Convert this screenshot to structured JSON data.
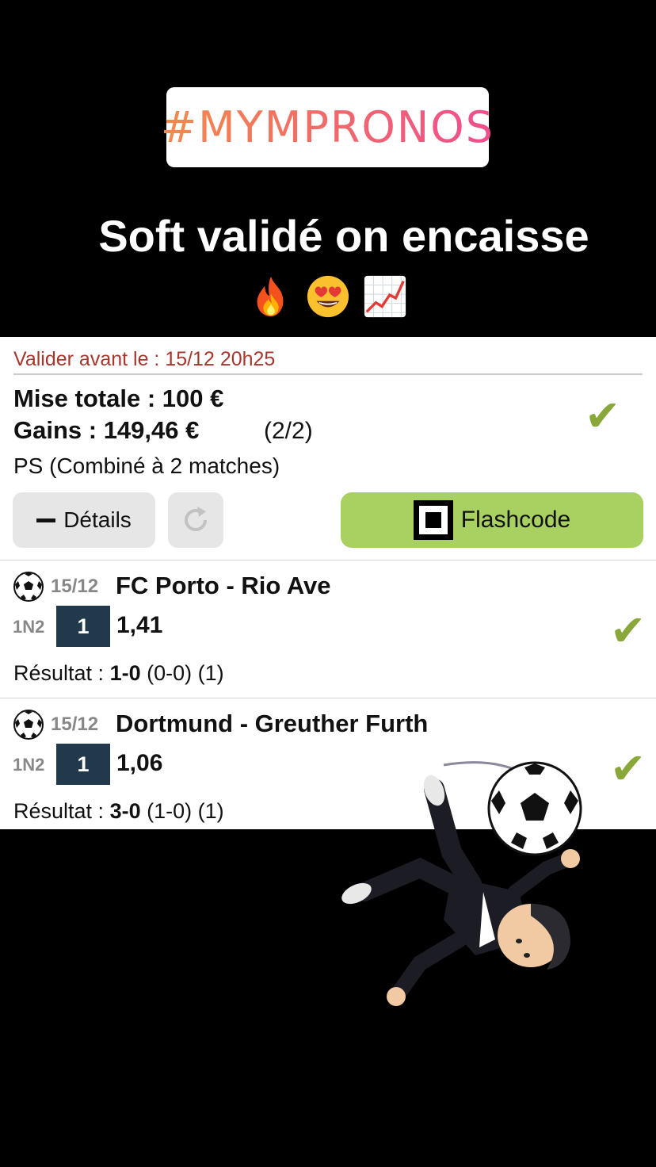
{
  "story": {
    "hashtag": "#MYMPRONOS",
    "caption": "Soft validé on encaisse",
    "emojis": [
      "fire",
      "heart-eyes",
      "chart-increasing"
    ]
  },
  "ticket": {
    "deadline": "Valider avant le : 15/12 20h25",
    "stake": "Mise totale : 100 €",
    "winnings": "Gains : 149,46 €",
    "count": "(2/2)",
    "type": "PS (Combiné à 2 matches)",
    "details_label": "Détails",
    "flashcode_label": "Flashcode",
    "status": "won",
    "colors": {
      "accent": "#a8d162",
      "check": "#8aa83a",
      "deadline": "#a8362c",
      "pick_bg": "#22394c"
    }
  },
  "matches": [
    {
      "date": "15/12",
      "teams": "FC Porto - Rio Ave",
      "bet_type": "1N2",
      "pick": "1",
      "odds": "1,41",
      "result_prefix": "Résultat : ",
      "result_score": "1-0",
      "result_suffix": " (0-0) (1)"
    },
    {
      "date": "15/12",
      "teams": "Dortmund - Greuther Furth",
      "bet_type": "1N2",
      "pick": "1",
      "odds": "1,06",
      "result_prefix": "Résultat : ",
      "result_score": "3-0",
      "result_suffix": " (1-0) (1)"
    }
  ]
}
